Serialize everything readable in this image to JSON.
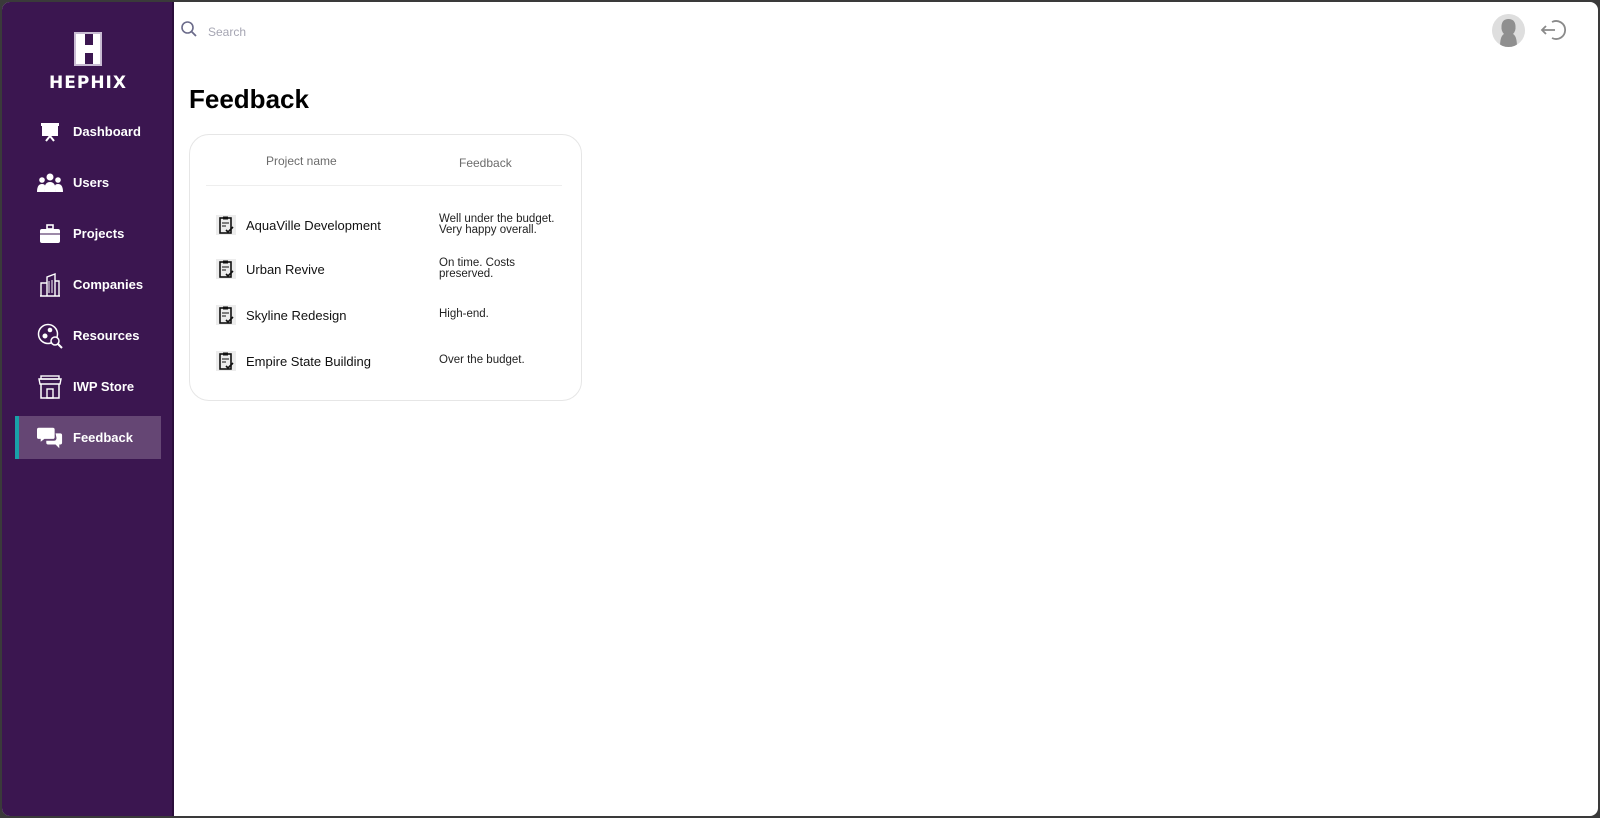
{
  "brand": {
    "name": "HEPHIX",
    "logo_letter": "H"
  },
  "sidebar": {
    "items": [
      {
        "label": "Dashboard",
        "icon": "presentation-board-icon",
        "active": false
      },
      {
        "label": "Users",
        "icon": "users-group-icon",
        "active": false
      },
      {
        "label": "Projects",
        "icon": "briefcase-icon",
        "active": false
      },
      {
        "label": "Companies",
        "icon": "buildings-icon",
        "active": false
      },
      {
        "label": "Resources",
        "icon": "resources-gear-search-icon",
        "active": false
      },
      {
        "label": "IWP Store",
        "icon": "storefront-icon",
        "active": false
      },
      {
        "label": "Feedback",
        "icon": "chat-bubbles-icon",
        "active": true
      }
    ],
    "accent_color": "#19a0a8",
    "background_color": "#3b1650"
  },
  "header": {
    "search": {
      "placeholder": "Search",
      "value": ""
    },
    "avatar_icon": "user-avatar-icon",
    "logout_icon": "logout-icon"
  },
  "page": {
    "title": "Feedback",
    "table": {
      "columns": [
        "Project name",
        "Feedback"
      ],
      "rows": [
        {
          "project": "AquaVille Development",
          "feedback": "Well under the budget. Very happy overall.",
          "icon": "clipboard-check-icon"
        },
        {
          "project": "Urban Revive",
          "feedback": "On time. Costs preserved.",
          "icon": "clipboard-check-icon"
        },
        {
          "project": "Skyline Redesign",
          "feedback": "High-end.",
          "icon": "clipboard-check-icon"
        },
        {
          "project": "Empire State Building",
          "feedback": "Over the budget.",
          "icon": "clipboard-check-icon"
        }
      ]
    }
  }
}
